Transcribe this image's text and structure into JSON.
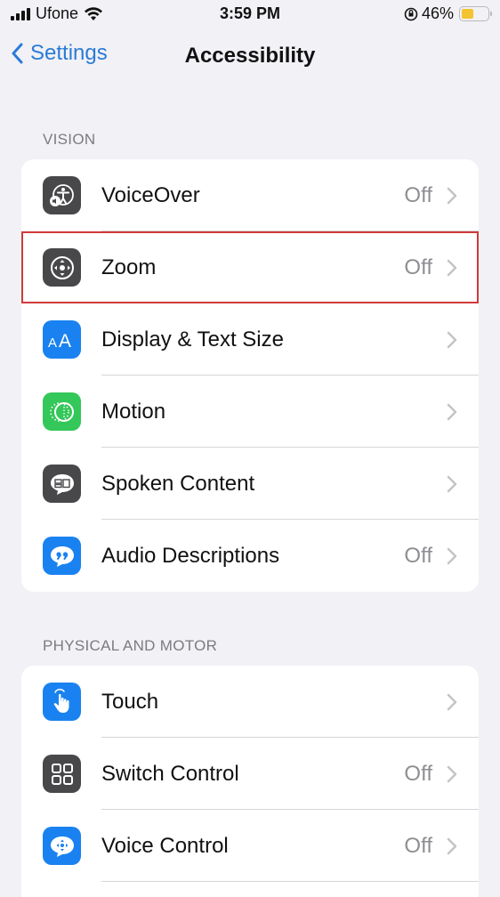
{
  "status_bar": {
    "carrier": "Ufone",
    "time": "3:59 PM",
    "battery_percent": "46%",
    "battery_level": 0.46,
    "icons": [
      "signal-icon",
      "wifi-icon",
      "orientation-lock-icon",
      "battery-icon"
    ]
  },
  "nav": {
    "back_label": "Settings",
    "title": "Accessibility"
  },
  "sections": [
    {
      "header": "VISION",
      "items": [
        {
          "label": "VoiceOver",
          "value": "Off",
          "icon": "voiceover-icon",
          "highlighted": false
        },
        {
          "label": "Zoom",
          "value": "Off",
          "icon": "zoom-icon",
          "highlighted": true
        },
        {
          "label": "Display & Text Size",
          "value": "",
          "icon": "display-text-size-icon",
          "highlighted": false
        },
        {
          "label": "Motion",
          "value": "",
          "icon": "motion-icon",
          "highlighted": false
        },
        {
          "label": "Spoken Content",
          "value": "",
          "icon": "spoken-content-icon",
          "highlighted": false
        },
        {
          "label": "Audio Descriptions",
          "value": "Off",
          "icon": "audio-descriptions-icon",
          "highlighted": false
        }
      ]
    },
    {
      "header": "PHYSICAL AND MOTOR",
      "items": [
        {
          "label": "Touch",
          "value": "",
          "icon": "touch-icon",
          "highlighted": false
        },
        {
          "label": "Switch Control",
          "value": "Off",
          "icon": "switch-control-icon",
          "highlighted": false
        },
        {
          "label": "Voice Control",
          "value": "Off",
          "icon": "voice-control-icon",
          "highlighted": false
        }
      ]
    }
  ],
  "colors": {
    "accent": "#2b7bd6",
    "highlight_border": "#d03a3a",
    "background": "#f1f1f6"
  }
}
